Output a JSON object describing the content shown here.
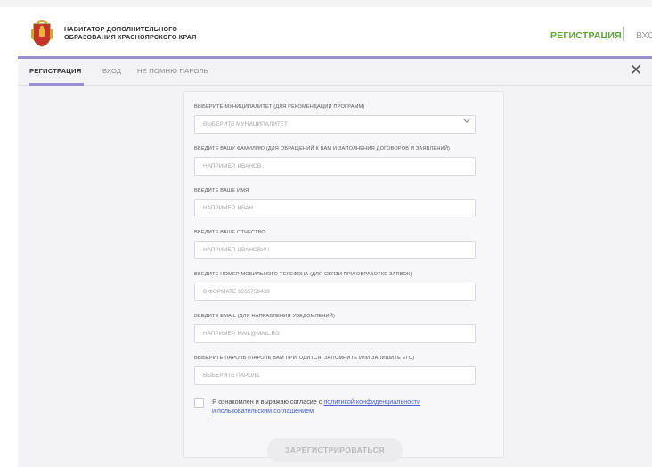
{
  "header": {
    "logo_line1": "НАВИГАТОР ДОПОЛНИТЕЛЬНОГО",
    "logo_line2": "ОБРАЗОВАНИЯ КРАСНОЯРСКОГО КРАЯ",
    "register_link": "РЕГИСТРАЦИЯ",
    "login_link": "ВХОД"
  },
  "tabs": [
    {
      "label": "РЕГИСТРАЦИЯ",
      "active": true
    },
    {
      "label": "ВХОД",
      "active": false
    },
    {
      "label": "НЕ ПОМНЮ ПАРОЛЬ",
      "active": false
    }
  ],
  "form": {
    "municipality": {
      "label": "ВЫБЕРИТЕ МУНИЦИПАЛИТЕТ (ДЛЯ РЕКОМЕНДАЦИИ ПРОГРАММ)",
      "placeholder": "ВЫБЕРИТЕ МУНИЦИПАЛИТЕТ"
    },
    "surname": {
      "label": "ВВЕДИТЕ ВАШУ ФАМИЛИЮ (ДЛЯ ОБРАЩЕНИЙ К ВАМ И ЗАПОЛНЕНИЯ ДОГОВОРОВ И ЗАЯВЛЕНИЙ)",
      "placeholder": "НАПРИМЕР, ИВАНОВ"
    },
    "name": {
      "label": "ВВЕДИТЕ ВАШЕ ИМЯ",
      "placeholder": "НАПРИМЕР, ИВАН"
    },
    "patronymic": {
      "label": "ВВЕДИТЕ ВАШЕ ОТЧЕСТВО",
      "placeholder": "НАПРИМЕР, ИВАНОВИЧ"
    },
    "phone": {
      "label": "ВВЕДИТЕ НОМЕР МОБИЛЬНОГО ТЕЛЕФОНА (ДЛЯ СВЯЗИ ПРИ ОБРАБОТКЕ ЗАЯВОК)",
      "placeholder": "В ФОРМАТЕ 9265758439"
    },
    "email": {
      "label": "ВВЕДИТЕ EMAIL (ДЛЯ НАПРАВЛЕНИЯ УВЕДОМЛЕНИЙ)",
      "placeholder": "НАПРИМЕР, MAIL@MAIL.RU"
    },
    "password": {
      "label": "ВЫБЕРИТЕ ПАРОЛЬ (ПАРОЛЬ ВАМ ПРИГОДИТСЯ, ЗАПОМНИТЕ ИЛИ ЗАПИШИТЕ ЕГО)",
      "placeholder": "ВЫБЕРИТЕ ПАРОЛЬ"
    },
    "consent": {
      "text_before": "Я ознакомлен и выражаю согласие с ",
      "link1": "политикой конфиденциальности",
      "link2": "и пользовательским соглашением"
    },
    "submit_label": "ЗАРЕГИСТРИРОВАТЬСЯ"
  },
  "colors": {
    "accent_green": "#5fa53a",
    "accent_purple": "#9b8fd0",
    "link_blue": "#4a5fc8"
  }
}
